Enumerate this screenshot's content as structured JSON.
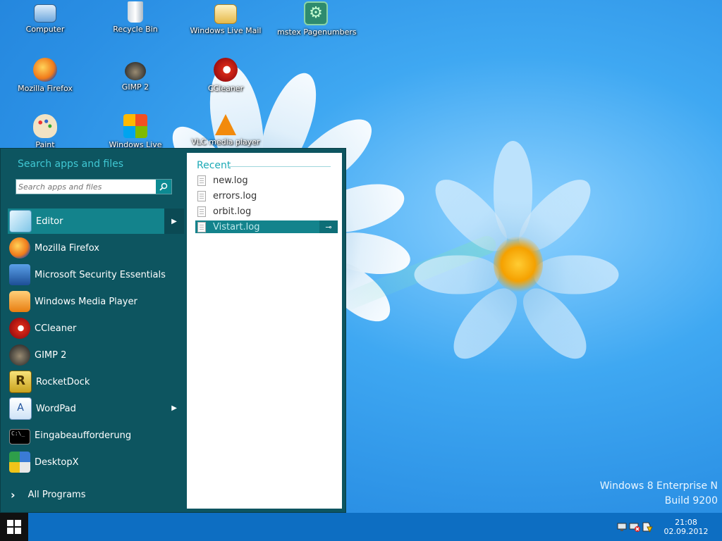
{
  "desktop": {
    "icons": [
      {
        "label": "Computer"
      },
      {
        "label": "Recycle Bin"
      },
      {
        "label": "Windows Live Mail"
      },
      {
        "label": "mstex Pagenumbers"
      },
      {
        "label": "Mozilla Firefox"
      },
      {
        "label": "GIMP 2"
      },
      {
        "label": "CCleaner"
      },
      {
        "label": "Paint"
      },
      {
        "label": "Windows Live"
      },
      {
        "label": "VLC media player"
      }
    ]
  },
  "startmenu": {
    "search_title": "Search apps and files",
    "search_placeholder": "Search apps and files",
    "programs": [
      {
        "label": "Editor",
        "selected": true,
        "submenu": true
      },
      {
        "label": "Mozilla Firefox"
      },
      {
        "label": "Microsoft Security Essentials"
      },
      {
        "label": "Windows Media Player"
      },
      {
        "label": "CCleaner"
      },
      {
        "label": "GIMP 2"
      },
      {
        "label": "RocketDock"
      },
      {
        "label": "WordPad",
        "submenu": true
      },
      {
        "label": "Eingabeaufforderung"
      },
      {
        "label": "DesktopX"
      }
    ],
    "all_programs": "All Programs",
    "recent_title": "Recent",
    "recent": [
      {
        "label": "new.log"
      },
      {
        "label": "errors.log"
      },
      {
        "label": "orbit.log"
      },
      {
        "label": "Vistart.log",
        "selected": true
      }
    ]
  },
  "osinfo": {
    "edition": "Windows 8 Enterprise N",
    "build": "Build 9200"
  },
  "taskbar": {
    "time": "21:08",
    "date": "02.09.2012"
  },
  "colors": {
    "menu_bg": "#0d5560",
    "selection": "#13838c",
    "accent_text": "#40c8d4",
    "taskbar": "#0d6ec2"
  }
}
